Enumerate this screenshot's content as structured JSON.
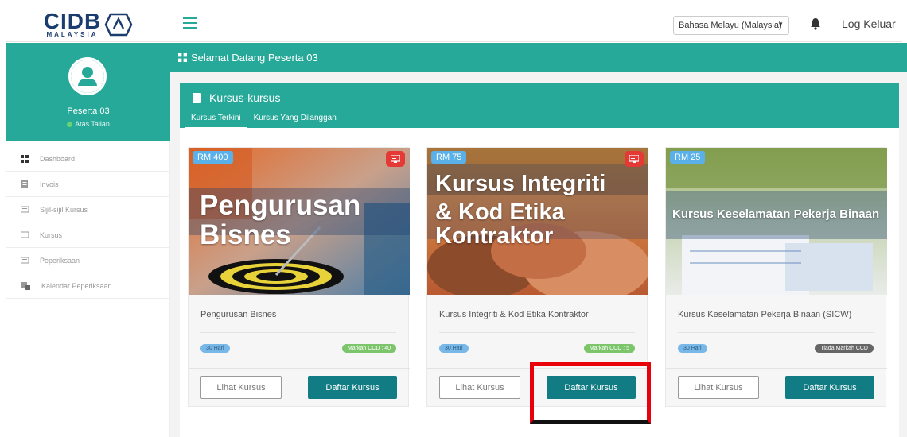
{
  "brand": {
    "logo_text": "CIDB",
    "logo_sub": "MALAYSIA"
  },
  "topbar": {
    "language": "Bahasa Melayu (Malaysia)",
    "logout": "Log Keluar"
  },
  "profile": {
    "name": "Peserta 03",
    "status": "Atas Talian"
  },
  "sidebar": {
    "items": [
      {
        "label": "Dashboard",
        "icon": "dashboard-icon"
      },
      {
        "label": "Invois",
        "icon": "invoice-icon"
      },
      {
        "label": "Sijil-sijil Kursus",
        "icon": "certificate-icon"
      },
      {
        "label": "Kursus",
        "icon": "course-icon"
      },
      {
        "label": "Peperiksaan",
        "icon": "exam-icon"
      },
      {
        "label": "Kalendar Peperiksaan",
        "icon": "calendar-icon"
      }
    ]
  },
  "welcome": "Selamat Datang Peserta 03",
  "panel": {
    "title": "Kursus-kursus",
    "tabs": [
      "Kursus Terkini",
      "Kursus Yang Dilanggan"
    ]
  },
  "courses": [
    {
      "price": "RM 400",
      "image_title": "Pengurusan Bisnes",
      "name": "Pengurusan Bisnes",
      "duration": "30 Hari",
      "ccd": "Markah CCD : 40",
      "view_label": "Lihat Kursus",
      "enroll_label": "Daftar Kursus"
    },
    {
      "price": "RM 75",
      "image_title_1": "Kursus Integriti",
      "image_title_2": "& Kod Etika Kontraktor",
      "name": "Kursus Integriti & Kod Etika Kontraktor",
      "duration": "30 Hari",
      "ccd": "Markah CCD : 5",
      "view_label": "Lihat Kursus",
      "enroll_label": "Daftar Kursus"
    },
    {
      "price": "RM 25",
      "image_title": "Kursus Keselamatan Pekerja Binaan",
      "name": "Kursus Keselamatan Pekerja Binaan (SICW)",
      "duration": "30 Hari",
      "ccd": "Tiada Markah CCD",
      "view_label": "Lihat Kursus",
      "enroll_label": "Daftar Kursus"
    }
  ],
  "colors": {
    "accent": "#27a99a",
    "button": "#127c84",
    "highlight": "#e8000b"
  }
}
